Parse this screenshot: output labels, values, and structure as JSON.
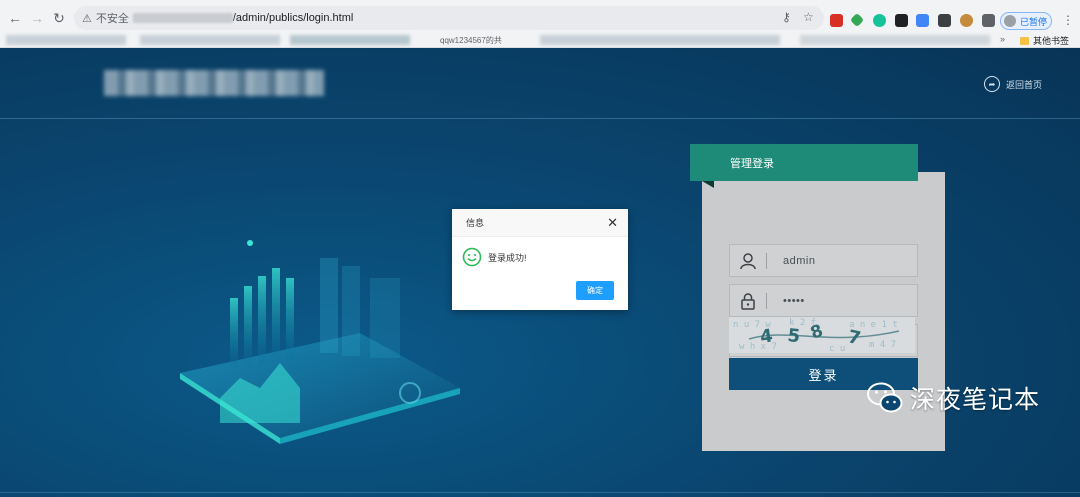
{
  "browser": {
    "insecure_label": "不安全",
    "url": "/admin/publics/login.html",
    "bookmark_partial": "qqw1234567的共",
    "other_bookmarks": "其他书签",
    "paused_label": "已暂停"
  },
  "header": {
    "home_link": "返回首页"
  },
  "login": {
    "tag_title": "管理登录",
    "username": "admin",
    "password": "•••••",
    "captcha_input": "4587",
    "submit_label": "登录",
    "captcha_chars": "4 5 8 7"
  },
  "dialog": {
    "title": "信息",
    "message": "登录成功!",
    "ok_label": "确定"
  },
  "watermark": {
    "text": "深夜笔记本"
  },
  "colors": {
    "page_bg": "#0a4670",
    "login_tag": "#1d8b77",
    "login_button": "#0e4f79",
    "dialog_ok": "#1e9fff",
    "smile": "#2cba5a"
  }
}
